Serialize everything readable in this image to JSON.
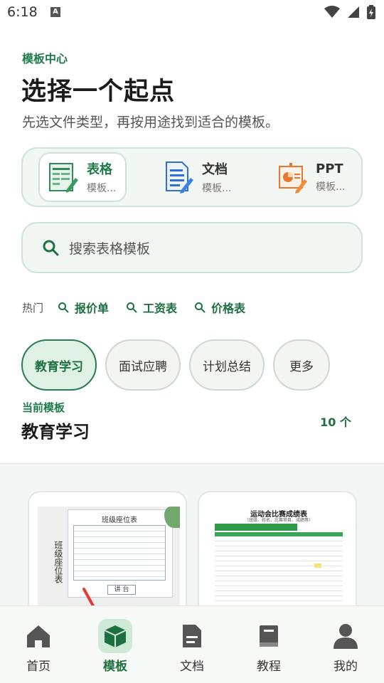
{
  "status": {
    "time": "6:18",
    "notif_letter": "A"
  },
  "header": {
    "eyebrow": "模板中心",
    "title": "选择一个起点",
    "subtitle": "先选文件类型，再按用途找到适合的模板。"
  },
  "file_types": [
    {
      "name": "表格",
      "sub": "模板...",
      "icon": "spreadsheet-icon",
      "active": true
    },
    {
      "name": "文档",
      "sub": "模板...",
      "icon": "document-icon",
      "active": false
    },
    {
      "name": "PPT",
      "sub": "模板...",
      "icon": "presentation-icon",
      "active": false
    }
  ],
  "search": {
    "placeholder": "搜索表格模板"
  },
  "hot": {
    "label": "热门",
    "links": [
      "报价单",
      "工资表",
      "价格表"
    ]
  },
  "categories": [
    {
      "label": "教育学习",
      "active": true
    },
    {
      "label": "面试应聘",
      "active": false
    },
    {
      "label": "计划总结",
      "active": false
    },
    {
      "label": "更多",
      "active": false
    }
  ],
  "current": {
    "eyebrow": "当前模板",
    "title": "教育学习",
    "count": "10 个"
  },
  "templates": [
    {
      "header_text": "班级座位表",
      "side_text": "班级座位表",
      "podium": "讲 台"
    },
    {
      "title": "运动会比赛成绩表",
      "subtitle": "（班级、姓名、比赛项目、成绩等）"
    }
  ],
  "nav": [
    {
      "label": "首页",
      "icon": "home-icon",
      "active": false
    },
    {
      "label": "模板",
      "icon": "template-box-icon",
      "active": true
    },
    {
      "label": "文档",
      "icon": "document-icon",
      "active": false
    },
    {
      "label": "教程",
      "icon": "book-icon",
      "active": false
    },
    {
      "label": "我的",
      "icon": "profile-icon",
      "active": false
    }
  ],
  "colors": {
    "accent": "#1e7a48",
    "chip_active_bg": "#dff0e5",
    "card_border": "#cde3d6",
    "arrow": "#e53935"
  }
}
